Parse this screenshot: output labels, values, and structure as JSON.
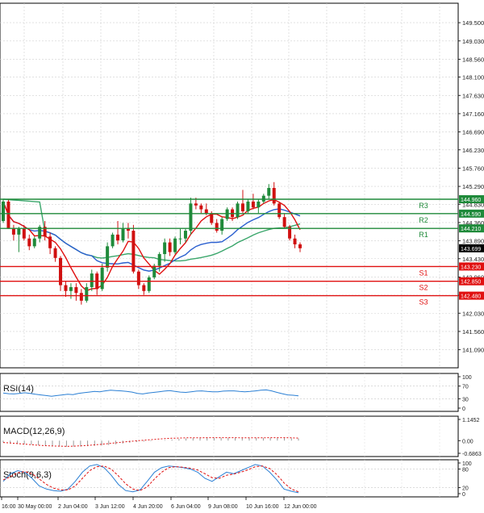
{
  "chart_data": [
    {
      "type": "candlestick",
      "panel": "price",
      "ylim": [
        140.625,
        150.0
      ],
      "y_ticks": [
        "149.500",
        "149.030",
        "148.560",
        "148.100",
        "147.630",
        "147.160",
        "146.690",
        "146.230",
        "145.760",
        "145.290",
        "144.830",
        "144.360",
        "143.890",
        "143.430",
        "142.960",
        "142.490",
        "142.030",
        "141.560",
        "141.090"
      ],
      "current_price": "143.699",
      "x_ticks": [
        "16:00",
        "30 May 00:00",
        "2 Jun 04:00",
        "3 Jun 12:00",
        "4 Jun 20:00",
        "6 Jun 04:00",
        "9 Jun 08:00",
        "10 Jun 16:00",
        "12 Jun 00:00"
      ],
      "levels": [
        {
          "name": "R3",
          "value": 144.96,
          "label": "144.960",
          "color": "#1f8a3a"
        },
        {
          "name": "R2",
          "value": 144.59,
          "label": "144.590",
          "color": "#1f8a3a"
        },
        {
          "name": "R1",
          "value": 144.21,
          "label": "144.210",
          "color": "#1f8a3a"
        },
        {
          "name": "S1",
          "value": 143.23,
          "label": "143.230",
          "color": "#e01010"
        },
        {
          "name": "S2",
          "value": 142.85,
          "label": "142.850",
          "color": "#e01010"
        },
        {
          "name": "S3",
          "value": 142.48,
          "label": "142.480",
          "color": "#e01010"
        }
      ],
      "candles": [
        [
          144.4,
          144.95,
          144.35,
          144.9
        ],
        [
          144.9,
          144.95,
          144.2,
          144.2
        ],
        [
          144.2,
          144.3,
          143.9,
          144.05
        ],
        [
          144.05,
          144.25,
          143.6,
          144.2
        ],
        [
          144.2,
          144.3,
          143.9,
          143.95
        ],
        [
          143.95,
          144.05,
          143.65,
          143.75
        ],
        [
          143.75,
          144.0,
          143.7,
          143.95
        ],
        [
          143.95,
          144.3,
          143.85,
          144.25
        ],
        [
          144.25,
          144.4,
          143.9,
          144.0
        ],
        [
          144.0,
          144.1,
          143.55,
          143.7
        ],
        [
          143.7,
          143.75,
          143.35,
          143.45
        ],
        [
          143.45,
          143.5,
          142.6,
          142.75
        ],
        [
          142.75,
          142.85,
          142.45,
          142.6
        ],
        [
          142.6,
          142.8,
          142.4,
          142.7
        ],
        [
          142.7,
          142.8,
          142.35,
          142.55
        ],
        [
          142.55,
          142.65,
          142.25,
          142.35
        ],
        [
          142.35,
          142.8,
          142.3,
          142.7
        ],
        [
          142.7,
          143.15,
          142.6,
          143.05
        ],
        [
          143.05,
          143.1,
          142.5,
          142.65
        ],
        [
          142.65,
          143.3,
          142.6,
          143.2
        ],
        [
          143.2,
          143.85,
          143.1,
          143.75
        ],
        [
          143.75,
          144.1,
          143.7,
          144.05
        ],
        [
          144.05,
          144.4,
          143.8,
          143.9
        ],
        [
          143.9,
          144.35,
          143.85,
          144.2
        ],
        [
          144.2,
          144.35,
          143.95,
          144.15
        ],
        [
          144.15,
          144.3,
          143.05,
          143.1
        ],
        [
          143.1,
          143.15,
          142.65,
          142.75
        ],
        [
          142.75,
          142.8,
          142.5,
          142.6
        ],
        [
          142.6,
          143.0,
          142.55,
          142.95
        ],
        [
          142.95,
          143.3,
          142.9,
          143.25
        ],
        [
          143.25,
          143.6,
          143.1,
          143.55
        ],
        [
          143.55,
          143.95,
          143.35,
          143.85
        ],
        [
          143.85,
          143.95,
          143.5,
          143.6
        ],
        [
          143.6,
          144.0,
          143.55,
          143.95
        ],
        [
          143.95,
          144.2,
          143.8,
          143.95
        ],
        [
          143.95,
          144.2,
          143.85,
          144.15
        ],
        [
          144.15,
          145.0,
          144.05,
          144.85
        ],
        [
          144.85,
          145.0,
          144.7,
          144.8
        ],
        [
          144.8,
          144.85,
          144.6,
          144.7
        ],
        [
          144.7,
          144.85,
          144.55,
          144.6
        ],
        [
          144.6,
          144.65,
          144.3,
          144.35
        ],
        [
          144.35,
          144.45,
          144.1,
          144.15
        ],
        [
          144.15,
          144.5,
          144.05,
          144.45
        ],
        [
          144.45,
          144.75,
          144.4,
          144.7
        ],
        [
          144.7,
          144.75,
          144.4,
          144.5
        ],
        [
          144.5,
          144.9,
          144.45,
          144.85
        ],
        [
          144.85,
          145.2,
          144.6,
          144.65
        ],
        [
          144.65,
          144.95,
          144.6,
          144.9
        ],
        [
          144.9,
          145.1,
          144.7,
          144.75
        ],
        [
          144.75,
          144.95,
          144.6,
          144.9
        ],
        [
          144.9,
          145.1,
          144.85,
          145.05
        ],
        [
          145.05,
          145.35,
          144.95,
          145.25
        ],
        [
          145.25,
          145.4,
          144.8,
          144.85
        ],
        [
          144.85,
          144.9,
          144.45,
          144.5
        ],
        [
          144.5,
          144.6,
          144.2,
          144.25
        ],
        [
          144.25,
          144.3,
          143.9,
          143.95
        ],
        [
          143.95,
          144.05,
          143.7,
          143.8
        ],
        [
          143.8,
          143.85,
          143.6,
          143.7
        ]
      ]
    },
    {
      "type": "line",
      "panel": "rsi",
      "title": "RSI(14)",
      "y_ticks": [
        "100",
        "70",
        "30",
        "0"
      ],
      "ylim": [
        0,
        100
      ],
      "values": [
        48,
        46,
        45,
        47,
        49,
        47,
        44,
        42,
        40,
        38,
        40,
        42,
        44,
        43,
        47,
        49,
        51,
        53,
        52,
        55,
        57,
        56,
        55,
        53,
        51,
        47,
        45,
        48,
        50,
        52,
        54,
        56,
        53,
        51,
        50,
        52,
        54,
        55,
        53,
        52,
        52,
        54,
        55,
        55,
        53,
        52,
        53,
        55,
        57,
        58,
        55,
        50,
        46,
        42,
        41,
        39
      ]
    },
    {
      "type": "bar",
      "panel": "macd",
      "title": "MACD(12,26,9)",
      "y_ticks": [
        "1.1452",
        "0.00",
        "-0.6863"
      ],
      "ylim": [
        -0.6863,
        1.1452
      ],
      "values": [
        -0.1,
        -0.15,
        -0.18,
        -0.2,
        -0.22,
        -0.25,
        -0.27,
        -0.3,
        -0.32,
        -0.33,
        -0.33,
        -0.32,
        -0.3,
        -0.28,
        -0.26,
        -0.24,
        -0.2,
        -0.16,
        -0.12,
        -0.08,
        -0.05,
        -0.03,
        0.0,
        0.03,
        0.06,
        0.09,
        0.12,
        0.14,
        0.15,
        0.15,
        0.15,
        0.15,
        0.15,
        0.15,
        0.15,
        0.15,
        0.15,
        0.15,
        0.15,
        0.15,
        0.14,
        0.13,
        0.12
      ],
      "signal": [
        -0.1,
        -0.13,
        -0.16,
        -0.19,
        -0.22,
        -0.25,
        -0.27,
        -0.29,
        -0.3,
        -0.31,
        -0.3,
        -0.28,
        -0.26,
        -0.23,
        -0.2,
        -0.16,
        -0.12,
        -0.08,
        -0.04,
        -0.01,
        0.02,
        0.05,
        0.08,
        0.11,
        0.13,
        0.14,
        0.15,
        0.15,
        0.15,
        0.16,
        0.16,
        0.16,
        0.16,
        0.16,
        0.15,
        0.15,
        0.15,
        0.15,
        0.16,
        0.16,
        0.16,
        0.15,
        0.14
      ]
    },
    {
      "type": "line",
      "panel": "stoch",
      "title": "Stoch(9,6,3)",
      "y_ticks": [
        "100",
        "80",
        "20",
        "0"
      ],
      "ylim": [
        0,
        100
      ],
      "k": [
        40,
        65,
        75,
        70,
        50,
        25,
        15,
        10,
        8,
        15,
        40,
        70,
        90,
        95,
        85,
        60,
        30,
        10,
        6,
        12,
        40,
        70,
        85,
        90,
        88,
        85,
        80,
        70,
        50,
        40,
        55,
        70,
        65,
        75,
        85,
        95,
        90,
        70,
        45,
        15,
        8,
        3
      ],
      "d": [
        45,
        55,
        68,
        72,
        65,
        48,
        30,
        18,
        12,
        12,
        25,
        50,
        75,
        88,
        90,
        80,
        58,
        32,
        15,
        10,
        22,
        48,
        70,
        85,
        88,
        86,
        83,
        77,
        65,
        52,
        50,
        60,
        64,
        70,
        78,
        88,
        90,
        82,
        62,
        35,
        15,
        6
      ]
    }
  ]
}
